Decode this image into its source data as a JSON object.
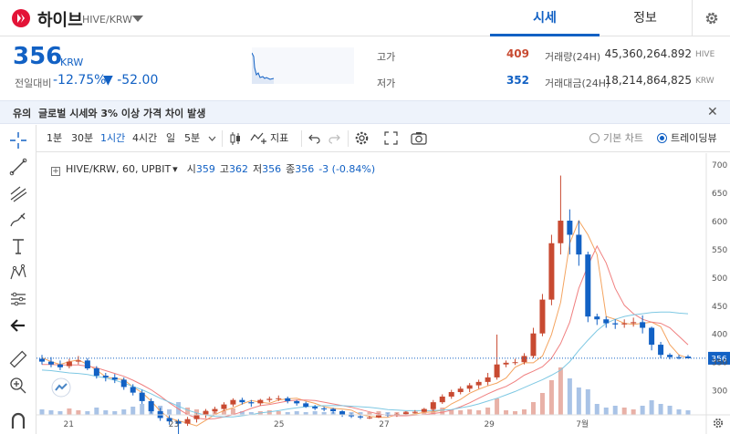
{
  "header": {
    "coin_name": "하이브",
    "pair": "HIVE/KRW",
    "tabs": [
      {
        "label": "시세",
        "active": true
      },
      {
        "label": "정보",
        "active": false
      }
    ]
  },
  "price": {
    "current": "356",
    "unit": "KRW",
    "change_label": "전일대비",
    "change_rate": "-12.75%",
    "change_amount": "▼ -52.00"
  },
  "stats": {
    "high_label": "고가",
    "high": "409",
    "low_label": "저가",
    "low": "352",
    "volume_label": "거래량(24H)",
    "volume": "45,360,264.892",
    "volume_unit": "HIVE",
    "amount_label": "거래대금(24H)",
    "amount": "18,214,864,825",
    "amount_unit": "KRW"
  },
  "notice": {
    "tag": "유의",
    "text": "글로벌 시세와 3% 이상 가격 차이 발생"
  },
  "toolbar": {
    "intervals": [
      "1분",
      "30분",
      "1시간",
      "4시간",
      "일",
      "5분"
    ],
    "active_interval": "1시간",
    "indicator_label": "지표",
    "basic_chart_label": "기본 차트",
    "tradingview_label": "트레이딩뷰"
  },
  "legend": {
    "symbol": "HIVE/KRW, 60, UPBIT",
    "open_label": "시",
    "open": "359",
    "high_label": "고",
    "high": "362",
    "low_label": "저",
    "low": "356",
    "close_label": "종",
    "close": "356",
    "change": "-3 (-0.84%)"
  },
  "colors": {
    "up": "#c84a31",
    "down": "#1261c4",
    "ma_short": "#f4a460",
    "ma_mid": "#f08080",
    "ma_long": "#7ec8e3",
    "brand": "#e31337"
  },
  "chart_data": {
    "type": "line",
    "x_ticks": [
      "21",
      "23",
      "25",
      "27",
      "29",
      "7월"
    ],
    "y_ticks": [
      300,
      350,
      400,
      450,
      500,
      550,
      600,
      650,
      700
    ],
    "ylim": [
      275,
      710
    ],
    "current_price_label": "356",
    "series": [
      {
        "values": [
          357,
          350,
          345,
          350,
          353,
          345,
          335,
          323,
          320,
          318,
          305,
          295,
          280,
          262,
          250,
          245,
          241,
          236,
          246,
          256,
          263,
          268,
          275,
          281,
          278,
          276,
          282,
          284,
          285,
          280,
          276,
          270,
          267,
          266,
          264,
          256,
          253,
          251,
          251,
          256,
          255,
          257,
          260,
          261,
          264,
          275,
          283,
          294,
          301,
          307,
          312,
          321,
          340,
          348,
          348,
          360,
          398,
          455,
          560,
          600,
          575,
          540,
          430,
          425,
          418,
          416,
          418,
          420,
          412,
          380,
          362,
          356
        ]
      },
      {
        "values": [
          345,
          345,
          344,
          344,
          344,
          342,
          339,
          334,
          329,
          324,
          317,
          309,
          300,
          289,
          277,
          266,
          256,
          250,
          248,
          249,
          252,
          256,
          261,
          267,
          272,
          274,
          277,
          280,
          282,
          282,
          281,
          278,
          275,
          272,
          269,
          265,
          261,
          257,
          255,
          254,
          254,
          255,
          256,
          258,
          260,
          264,
          270,
          277,
          285,
          293,
          300,
          306,
          315,
          326,
          333,
          341,
          356,
          382,
          420,
          480,
          520,
          555,
          525,
          480,
          450,
          435,
          425,
          420,
          418,
          410,
          395,
          380
        ]
      },
      {
        "values": [
          335,
          334,
          332,
          330,
          329,
          327,
          324,
          321,
          317,
          312,
          306,
          300,
          293,
          285,
          278,
          271,
          264,
          259,
          255,
          253,
          252,
          252,
          254,
          256,
          259,
          261,
          263,
          266,
          268,
          270,
          271,
          272,
          272,
          272,
          271,
          270,
          269,
          267,
          265,
          264,
          263,
          263,
          263,
          263,
          264,
          265,
          268,
          271,
          275,
          280,
          285,
          291,
          297,
          304,
          311,
          318,
          326,
          335,
          350,
          370,
          388,
          405,
          418,
          425,
          430,
          433,
          435,
          437,
          438,
          438,
          436,
          435
        ]
      }
    ],
    "candles": [
      [
        355,
        362,
        345,
        350
      ],
      [
        350,
        358,
        340,
        345
      ],
      [
        345,
        352,
        335,
        340
      ],
      [
        342,
        355,
        338,
        350
      ],
      [
        350,
        360,
        345,
        352
      ],
      [
        352,
        356,
        335,
        338
      ],
      [
        338,
        342,
        320,
        325
      ],
      [
        325,
        330,
        315,
        322
      ],
      [
        322,
        328,
        312,
        318
      ],
      [
        318,
        322,
        300,
        305
      ],
      [
        305,
        310,
        290,
        295
      ],
      [
        295,
        300,
        275,
        280
      ],
      [
        280,
        285,
        258,
        262
      ],
      [
        262,
        268,
        245,
        250
      ],
      [
        250,
        255,
        238,
        244
      ],
      [
        244,
        248,
        200,
        240
      ],
      [
        240,
        252,
        236,
        248
      ],
      [
        248,
        258,
        242,
        255
      ],
      [
        255,
        266,
        250,
        262
      ],
      [
        262,
        270,
        258,
        266
      ],
      [
        266,
        278,
        262,
        274
      ],
      [
        274,
        285,
        270,
        282
      ],
      [
        282,
        286,
        274,
        278
      ],
      [
        278,
        282,
        270,
        276
      ],
      [
        276,
        284,
        272,
        282
      ],
      [
        282,
        288,
        278,
        284
      ],
      [
        284,
        290,
        280,
        285
      ],
      [
        285,
        288,
        276,
        280
      ],
      [
        280,
        282,
        272,
        276
      ],
      [
        276,
        279,
        268,
        270
      ],
      [
        270,
        273,
        264,
        267
      ],
      [
        267,
        270,
        262,
        266
      ],
      [
        266,
        268,
        258,
        262
      ],
      [
        262,
        264,
        252,
        256
      ],
      [
        256,
        258,
        250,
        253
      ],
      [
        253,
        256,
        248,
        251
      ],
      [
        251,
        254,
        248,
        251
      ],
      [
        251,
        258,
        250,
        256
      ],
      [
        256,
        258,
        252,
        255
      ],
      [
        255,
        259,
        252,
        257
      ],
      [
        257,
        262,
        255,
        260
      ],
      [
        260,
        264,
        258,
        261
      ],
      [
        261,
        268,
        260,
        266
      ],
      [
        266,
        282,
        262,
        278
      ],
      [
        278,
        292,
        275,
        288
      ],
      [
        288,
        300,
        284,
        296
      ],
      [
        296,
        306,
        292,
        302
      ],
      [
        302,
        312,
        296,
        308
      ],
      [
        308,
        318,
        302,
        314
      ],
      [
        314,
        330,
        308,
        322
      ],
      [
        322,
        398,
        318,
        345
      ],
      [
        345,
        352,
        340,
        348
      ],
      [
        348,
        355,
        344,
        349
      ],
      [
        349,
        365,
        345,
        360
      ],
      [
        360,
        410,
        356,
        400
      ],
      [
        400,
        470,
        395,
        460
      ],
      [
        460,
        575,
        450,
        560
      ],
      [
        560,
        680,
        540,
        600
      ],
      [
        600,
        620,
        540,
        575
      ],
      [
        575,
        600,
        520,
        540
      ],
      [
        540,
        545,
        420,
        430
      ],
      [
        430,
        435,
        415,
        425
      ],
      [
        425,
        430,
        410,
        418
      ],
      [
        418,
        425,
        408,
        416
      ],
      [
        416,
        425,
        410,
        418
      ],
      [
        418,
        428,
        412,
        420
      ],
      [
        420,
        432,
        400,
        410
      ],
      [
        410,
        412,
        370,
        380
      ],
      [
        380,
        385,
        356,
        362
      ],
      [
        362,
        365,
        354,
        358
      ],
      [
        358,
        362,
        354,
        357
      ],
      [
        359,
        362,
        356,
        356
      ]
    ],
    "volumes": [
      6,
      5,
      4,
      7,
      5,
      4,
      8,
      5,
      4,
      6,
      9,
      12,
      8,
      10,
      6,
      14,
      8,
      6,
      5,
      4,
      5,
      7,
      4,
      3,
      4,
      5,
      4,
      3,
      4,
      3,
      4,
      3,
      3,
      4,
      3,
      3,
      3,
      4,
      3,
      3,
      4,
      3,
      4,
      12,
      8,
      6,
      5,
      6,
      5,
      8,
      18,
      5,
      4,
      6,
      14,
      24,
      38,
      52,
      40,
      30,
      28,
      12,
      8,
      10,
      8,
      6,
      10,
      16,
      12,
      10,
      6,
      5
    ]
  }
}
